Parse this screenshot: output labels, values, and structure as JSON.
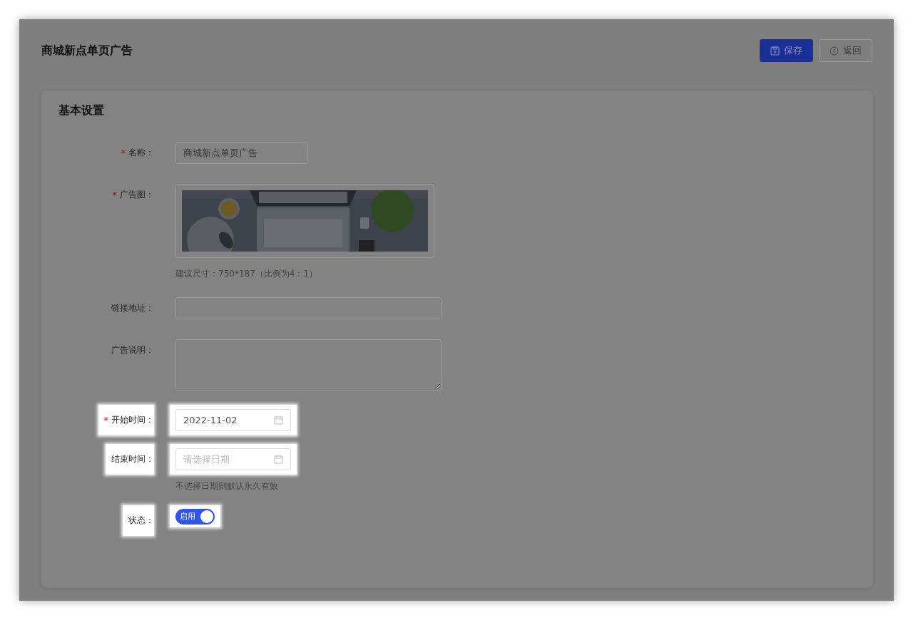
{
  "page": {
    "title": "商城新点单页广告",
    "buttons": [
      {
        "kind": "primary",
        "label": "保存"
      },
      {
        "kind": "back",
        "label": "返回"
      }
    ]
  },
  "section": {
    "title": "基本设置",
    "fields": [
      {
        "kind": "text",
        "label": "名称：",
        "required_mark": "*",
        "highlighted": false,
        "value": "商城新点单页广告"
      },
      {
        "label": "广告图：",
        "required_mark": "*",
        "highlighted": false,
        "hint": "建议尺寸：750*187（比例为4：1）"
      },
      {
        "kind": "text",
        "label": "链接地址：",
        "highlighted": false
      },
      {
        "kind": "textarea",
        "label": "广告说明：",
        "highlighted": false
      },
      {
        "kind": "date",
        "label": "开始时间：",
        "required_mark": "*",
        "highlighted": true,
        "value": "2022-11-02"
      },
      {
        "kind": "date",
        "label": "结束时间：",
        "highlighted": true,
        "placeholder": "请选择日期",
        "hint": "不选择日期则默认永久有效"
      },
      {
        "kind": "switch",
        "label": "状态：",
        "highlighted": true,
        "on": true,
        "text": "启用"
      }
    ]
  }
}
